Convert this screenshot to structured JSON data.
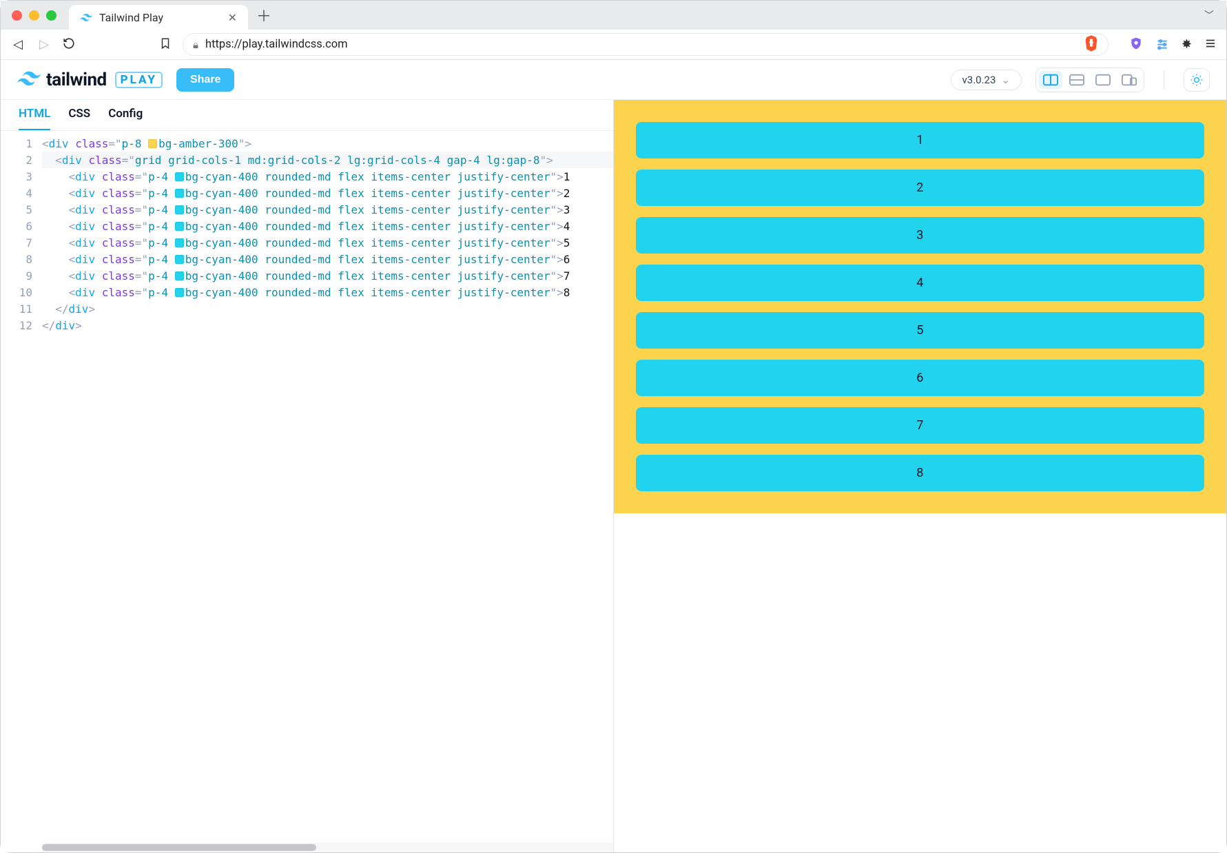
{
  "browser": {
    "tab_title": "Tailwind Play",
    "url": "https://play.tailwindcss.com"
  },
  "app": {
    "brand_word": "tailwind",
    "brand_play": "PLAY",
    "share_label": "Share",
    "version": "v3.0.23"
  },
  "editor": {
    "tabs": {
      "html": "HTML",
      "css": "CSS",
      "config": "Config"
    },
    "line_numbers": [
      "1",
      "2",
      "3",
      "4",
      "5",
      "6",
      "7",
      "8",
      "9",
      "10",
      "11",
      "12"
    ],
    "code": {
      "l1": {
        "cls": "p-8 ",
        "color_cls": "bg-amber-300"
      },
      "l2": {
        "cls": "grid grid-cols-1 md:grid-cols-2 lg:grid-cols-4 gap-4 lg:gap-8"
      },
      "item_prefix": "p-4 ",
      "item_color_cls": "bg-cyan-400",
      "item_suffix": " rounded-md flex items-center justify-center",
      "items": [
        "1",
        "2",
        "3",
        "4",
        "5",
        "6",
        "7",
        "8"
      ],
      "close1": "div",
      "close2": "div"
    }
  },
  "preview": {
    "items": [
      "1",
      "2",
      "3",
      "4",
      "5",
      "6",
      "7",
      "8"
    ]
  }
}
